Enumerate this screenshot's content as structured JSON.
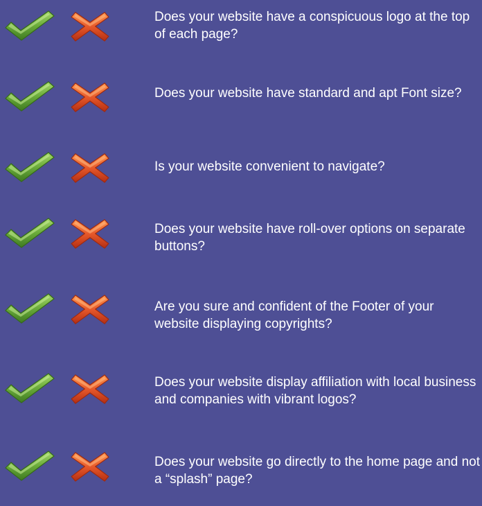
{
  "colors": {
    "background": "#4e4f95",
    "check_green": "#6aab3a",
    "cross_orange": "#e6582a"
  },
  "icons": {
    "yes": "check-mark-icon",
    "no": "cross-mark-icon"
  },
  "questions": [
    "Does your website have a conspicuous logo at the top of each page?",
    "Does your website have standard and apt Font size?",
    "Is your website convenient to navigate?",
    "Does your website have roll-over options on separate buttons?",
    "Are you sure and confident of the Footer of your website displaying copyrights?",
    "Does your website display affiliation with local business and companies with vibrant logos?",
    "Does your website go directly to the home page and not a “splash” page?"
  ]
}
